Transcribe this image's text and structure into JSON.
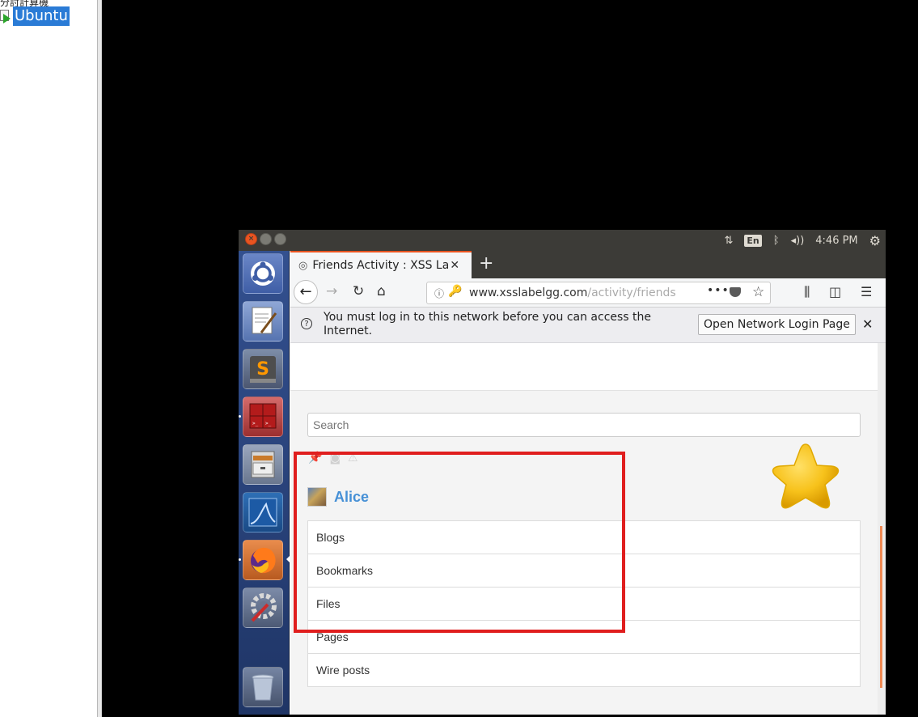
{
  "host": {
    "tree_cut_text": "分討計算機",
    "vm_label": "Ubuntu"
  },
  "topbar": {
    "language": "En",
    "volume_symbol": "◂))",
    "clock": "4:46 PM"
  },
  "browser": {
    "tab_title": "Friends Activity : XSS Lab",
    "url_main": "www.xsslabelgg.com",
    "url_rest": "/activity/friends",
    "notification_message": "You must log in to this network before you can access the Internet.",
    "notification_button": "Open Network Login Page"
  },
  "page": {
    "search_placeholder": "Search",
    "profile_name": "Alice",
    "menu_items": [
      "Blogs",
      "Bookmarks",
      "Files",
      "Pages",
      "Wire posts"
    ]
  },
  "colors": {
    "accent": "#e95420",
    "link": "#4690d6",
    "highlight_box": "#e01e1e",
    "launcher": "#2a4478"
  },
  "icons": [
    "ubuntu-logo-icon",
    "text-editor-icon",
    "sublime-icon",
    "terminal-icon",
    "file-cabinet-icon",
    "wireshark-icon",
    "firefox-icon",
    "settings-icon",
    "trash-icon",
    "star-icon"
  ]
}
